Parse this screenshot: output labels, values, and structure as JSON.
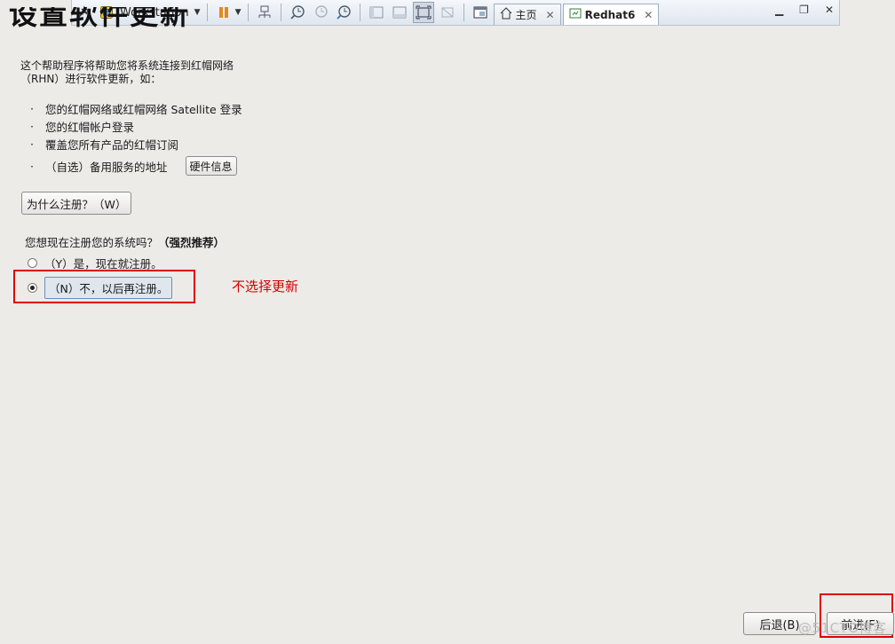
{
  "vmware_toolbar": {
    "product_label": "Workstation",
    "tabs": [
      {
        "label": "主页",
        "icon": "home-icon"
      },
      {
        "label": "Redhat6",
        "icon": "vm-icon"
      }
    ]
  },
  "page": {
    "title": "设置软件更新",
    "intro_line1": "这个帮助程序将帮助您将系统连接到红帽网络",
    "intro_line2": "（RHN）进行软件更新，如：",
    "bullets": [
      "您的红帽网络或红帽网络 Satellite 登录",
      "您的红帽帐户登录",
      "覆盖您所有产品的红帽订阅",
      "（自选）备用服务的地址"
    ],
    "hardware_button": "硬件信息",
    "why_button": "为什么注册？（W）",
    "question": "您想现在注册您的系统吗？",
    "question_emphasis": "（强烈推荐）",
    "radio_yes": "（Y）是，现在就注册。",
    "radio_no": "（N）不，以后再注册。",
    "selected_option": "no"
  },
  "annotation": {
    "note": "不选择更新",
    "color": "#e00000"
  },
  "footer": {
    "back_button": "后退(B)",
    "next_button": "前进(F)"
  },
  "watermark": "@51CTO博客"
}
